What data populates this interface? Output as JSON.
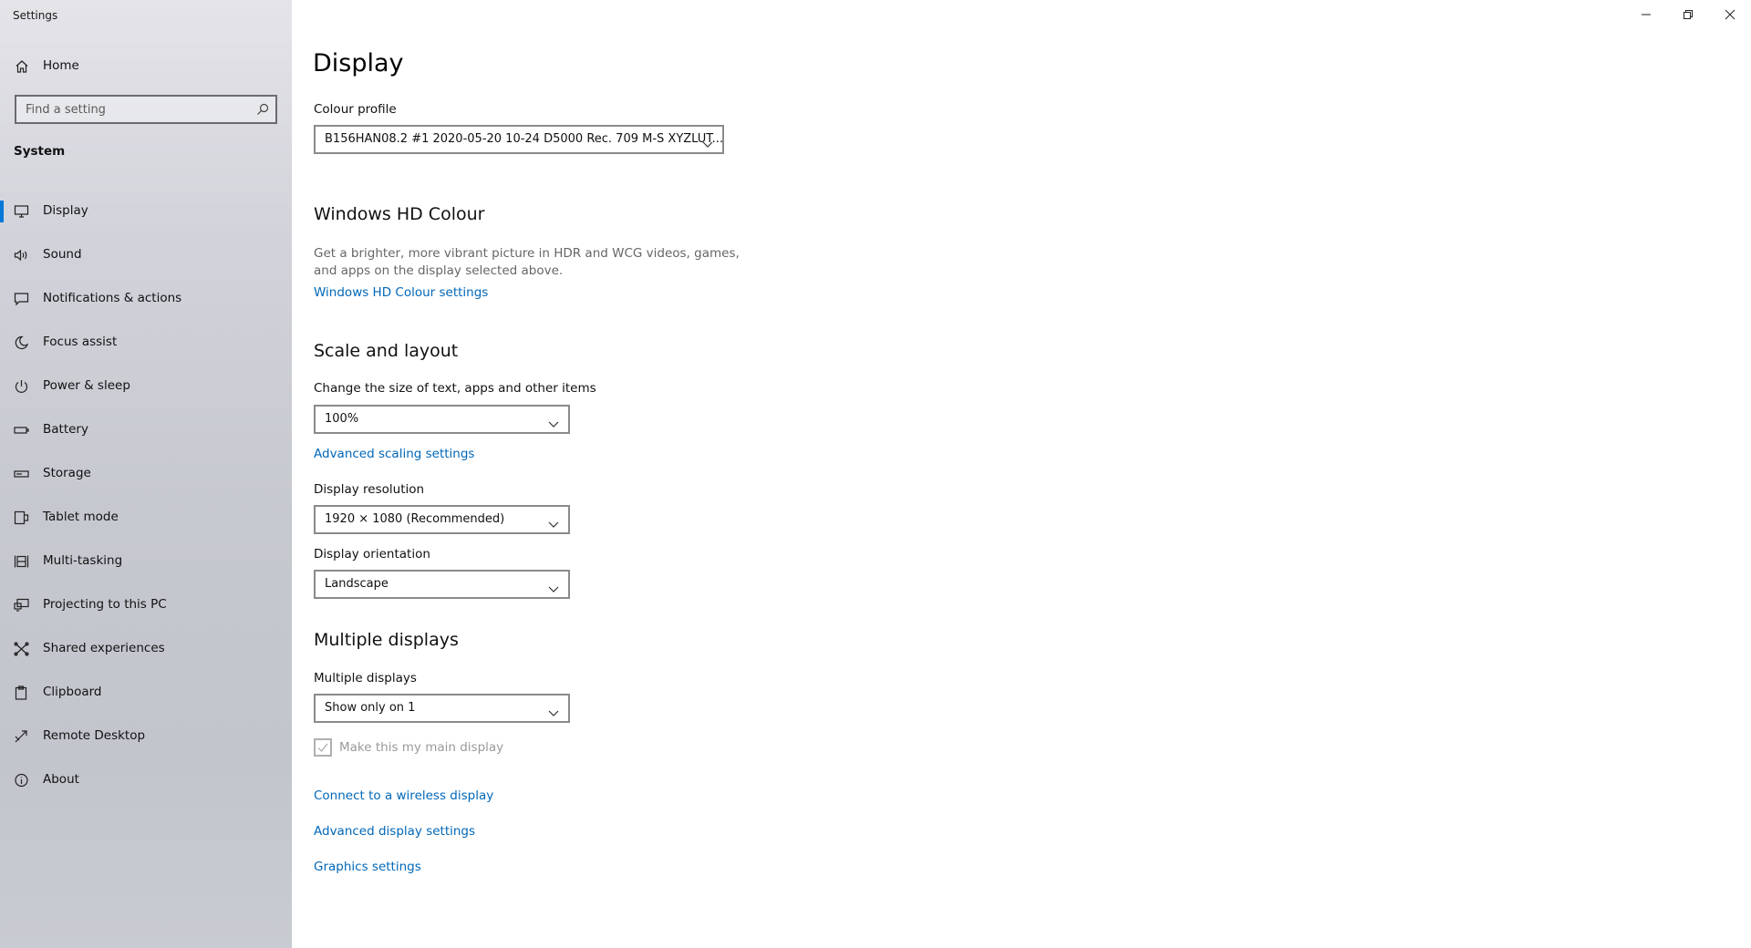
{
  "window": {
    "title": "Settings"
  },
  "sidebar": {
    "home_label": "Home",
    "search_placeholder": "Find a setting",
    "section": "System",
    "items": [
      {
        "label": "Display",
        "icon": "monitor-icon",
        "active": true
      },
      {
        "label": "Sound",
        "icon": "speaker-icon"
      },
      {
        "label": "Notifications & actions",
        "icon": "notification-icon"
      },
      {
        "label": "Focus assist",
        "icon": "moon-icon"
      },
      {
        "label": "Power & sleep",
        "icon": "power-icon"
      },
      {
        "label": "Battery",
        "icon": "battery-icon"
      },
      {
        "label": "Storage",
        "icon": "storage-icon"
      },
      {
        "label": "Tablet mode",
        "icon": "tablet-icon"
      },
      {
        "label": "Multi-tasking",
        "icon": "multitasking-icon"
      },
      {
        "label": "Projecting to this PC",
        "icon": "projecting-icon"
      },
      {
        "label": "Shared experiences",
        "icon": "shared-icon"
      },
      {
        "label": "Clipboard",
        "icon": "clipboard-icon"
      },
      {
        "label": "Remote Desktop",
        "icon": "remote-desktop-icon"
      },
      {
        "label": "About",
        "icon": "info-icon"
      }
    ]
  },
  "main": {
    "title": "Display",
    "colour_profile": {
      "label": "Colour profile",
      "value": "B156HAN08.2 #1 2020-05-20 10-24 D5000 Rec. 709 M-S XYZLUT..."
    },
    "hd_colour": {
      "heading": "Windows HD Colour",
      "description": "Get a brighter, more vibrant picture in HDR and WCG videos, games, and apps on the display selected above.",
      "link": "Windows HD Colour settings"
    },
    "scale_layout": {
      "heading": "Scale and layout",
      "size_label": "Change the size of text, apps and other items",
      "size_value": "100%",
      "advanced_link": "Advanced scaling settings",
      "resolution_label": "Display resolution",
      "resolution_value": "1920 × 1080 (Recommended)",
      "orientation_label": "Display orientation",
      "orientation_value": "Landscape"
    },
    "multiple_displays": {
      "heading": "Multiple displays",
      "label": "Multiple displays",
      "value": "Show only on 1",
      "checkbox_label": "Make this my main display",
      "checkbox_checked": true,
      "links": [
        "Connect to a wireless display",
        "Advanced display settings",
        "Graphics settings"
      ]
    }
  },
  "colors": {
    "accent": "#0078d7",
    "link": "#0067b8"
  }
}
